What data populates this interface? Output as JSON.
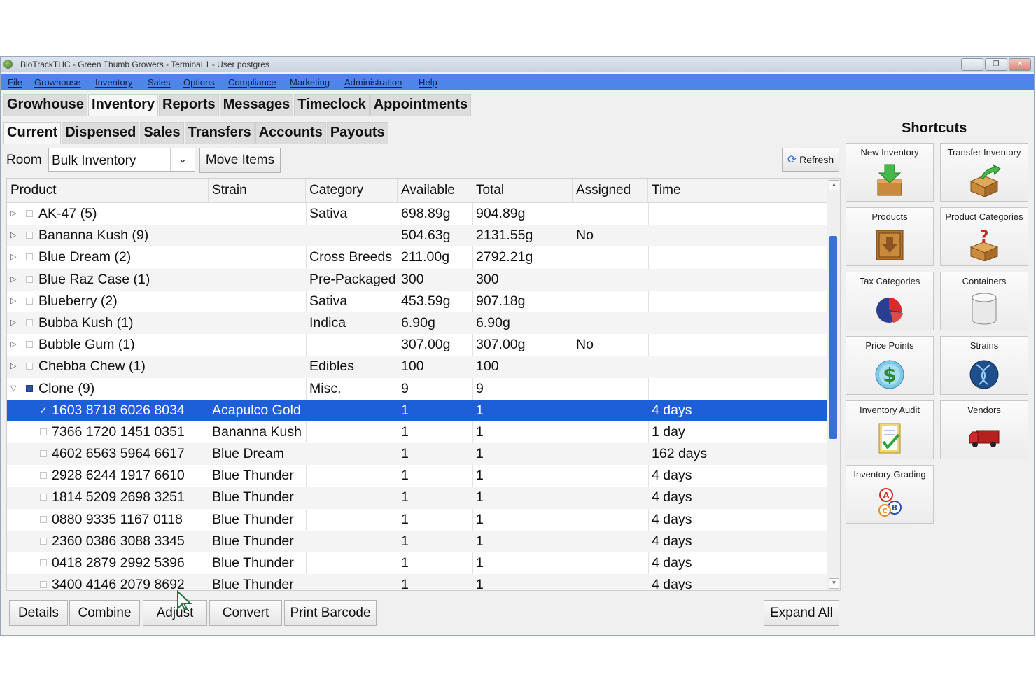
{
  "window": {
    "title": "BioTrackTHC - Green Thumb Growers - Terminal 1 - User postgres",
    "controls": [
      "minimize",
      "restore",
      "close"
    ]
  },
  "menu": [
    "File",
    "Growhouse",
    "Inventory",
    "Sales",
    "Options",
    "Compliance",
    "Marketing",
    "Administration",
    "Help"
  ],
  "top_tabs": [
    {
      "label": "Growhouse",
      "active": false
    },
    {
      "label": "Inventory",
      "active": true
    },
    {
      "label": "Reports",
      "active": false
    },
    {
      "label": "Messages",
      "active": false
    },
    {
      "label": "Timeclock",
      "active": false
    },
    {
      "label": "Appointments",
      "active": false
    }
  ],
  "sub_tabs": [
    {
      "label": "Current",
      "active": true
    },
    {
      "label": "Dispensed",
      "active": false
    },
    {
      "label": "Sales",
      "active": false
    },
    {
      "label": "Transfers",
      "active": false
    },
    {
      "label": "Accounts",
      "active": false
    },
    {
      "label": "Payouts",
      "active": false
    }
  ],
  "toolbar": {
    "room_label": "Room",
    "room_value": "Bulk Inventory",
    "move_items": "Move Items",
    "refresh": "Refresh"
  },
  "grid": {
    "columns": [
      "Product",
      "Strain",
      "Category",
      "Available",
      "Total",
      "Assigned",
      "Time"
    ],
    "rows": [
      {
        "level": 0,
        "expanded": false,
        "checked": false,
        "product": "AK-47 (5)",
        "strain": "",
        "category": "Sativa",
        "available": "698.89g",
        "total": "904.89g",
        "assigned": "",
        "time": ""
      },
      {
        "level": 0,
        "expanded": false,
        "checked": false,
        "product": "Bananna Kush (9)",
        "strain": "",
        "category": "",
        "available": "504.63g",
        "total": "2131.55g",
        "assigned": "No",
        "time": ""
      },
      {
        "level": 0,
        "expanded": false,
        "checked": false,
        "product": "Blue Dream  (2)",
        "strain": "",
        "category": "Cross Breeds",
        "available": "211.00g",
        "total": "2792.21g",
        "assigned": "",
        "time": ""
      },
      {
        "level": 0,
        "expanded": false,
        "checked": false,
        "product": "Blue Raz Case (1)",
        "strain": "",
        "category": "Pre-Packaged",
        "available": "300",
        "total": "300",
        "assigned": "",
        "time": ""
      },
      {
        "level": 0,
        "expanded": false,
        "checked": false,
        "product": "Blueberry (2)",
        "strain": "",
        "category": "Sativa",
        "available": "453.59g",
        "total": "907.18g",
        "assigned": "",
        "time": ""
      },
      {
        "level": 0,
        "expanded": false,
        "checked": false,
        "product": "Bubba Kush  (1)",
        "strain": "",
        "category": "Indica",
        "available": "6.90g",
        "total": "6.90g",
        "assigned": "",
        "time": ""
      },
      {
        "level": 0,
        "expanded": false,
        "checked": false,
        "product": "Bubble Gum (1)",
        "strain": "",
        "category": "",
        "available": "307.00g",
        "total": "307.00g",
        "assigned": "No",
        "time": ""
      },
      {
        "level": 0,
        "expanded": false,
        "checked": false,
        "product": "Chebba Chew (1)",
        "strain": "",
        "category": "Edibles",
        "available": "100",
        "total": "100",
        "assigned": "",
        "time": ""
      },
      {
        "level": 0,
        "expanded": true,
        "checked": true,
        "product": "Clone  (9)",
        "strain": "",
        "category": "Misc.",
        "available": "9",
        "total": "9",
        "assigned": "",
        "time": ""
      },
      {
        "level": 1,
        "selected": true,
        "checked": true,
        "product": "1603 8718 6026 8034",
        "strain": "Acapulco Gold",
        "category": "",
        "available": "1",
        "total": "1",
        "assigned": "",
        "time": "4 days"
      },
      {
        "level": 1,
        "checked": false,
        "product": "7366 1720 1451 0351",
        "strain": "Bananna Kush",
        "category": "",
        "available": "1",
        "total": "1",
        "assigned": "",
        "time": "1 day"
      },
      {
        "level": 1,
        "checked": false,
        "product": "4602 6563 5964 6617",
        "strain": "Blue Dream",
        "category": "",
        "available": "1",
        "total": "1",
        "assigned": "",
        "time": "162 days"
      },
      {
        "level": 1,
        "checked": false,
        "product": "2928 6244 1917 6610",
        "strain": "Blue Thunder",
        "category": "",
        "available": "1",
        "total": "1",
        "assigned": "",
        "time": "4 days"
      },
      {
        "level": 1,
        "checked": false,
        "product": "1814 5209 2698 3251",
        "strain": "Blue Thunder",
        "category": "",
        "available": "1",
        "total": "1",
        "assigned": "",
        "time": "4 days"
      },
      {
        "level": 1,
        "checked": false,
        "product": "0880 9335 1167 0118",
        "strain": "Blue Thunder",
        "category": "",
        "available": "1",
        "total": "1",
        "assigned": "",
        "time": "4 days"
      },
      {
        "level": 1,
        "checked": false,
        "product": "2360 0386 3088 3345",
        "strain": "Blue Thunder",
        "category": "",
        "available": "1",
        "total": "1",
        "assigned": "",
        "time": "4 days"
      },
      {
        "level": 1,
        "checked": false,
        "product": "0418 2879 2992 5396",
        "strain": "Blue Thunder",
        "category": "",
        "available": "1",
        "total": "1",
        "assigned": "",
        "time": "4 days"
      },
      {
        "level": 1,
        "checked": false,
        "product": "3400 4146 2079 8692",
        "strain": "Blue Thunder",
        "category": "",
        "available": "1",
        "total": "1",
        "assigned": "",
        "time": "4 days"
      }
    ]
  },
  "bottom_buttons": {
    "details": "Details",
    "combine": "Combine",
    "adjust": "Adjust",
    "convert": "Convert",
    "print_barcode": "Print Barcode",
    "expand_all": "Expand All"
  },
  "shortcuts": {
    "title": "Shortcuts",
    "items": [
      {
        "label": "New Inventory",
        "icon": "new-inventory-box-icon"
      },
      {
        "label": "Transfer Inventory",
        "icon": "transfer-box-icon"
      },
      {
        "label": "Products",
        "icon": "products-box-icon"
      },
      {
        "label": "Product Categories",
        "icon": "question-box-icon"
      },
      {
        "label": "Tax Categories",
        "icon": "pie-chart-icon"
      },
      {
        "label": "Containers",
        "icon": "container-cylinder-icon"
      },
      {
        "label": "Price Points",
        "icon": "dollar-coin-icon"
      },
      {
        "label": "Strains",
        "icon": "dna-globe-icon"
      },
      {
        "label": "Inventory Audit",
        "icon": "clipboard-check-icon"
      },
      {
        "label": "Vendors",
        "icon": "truck-icon"
      },
      {
        "label": "Inventory Grading",
        "icon": "abc-grade-icon"
      }
    ]
  },
  "colors": {
    "menubar": "#4d86e8",
    "selection": "#1e5fd8",
    "scroll_thumb": "#3a6fd4"
  }
}
